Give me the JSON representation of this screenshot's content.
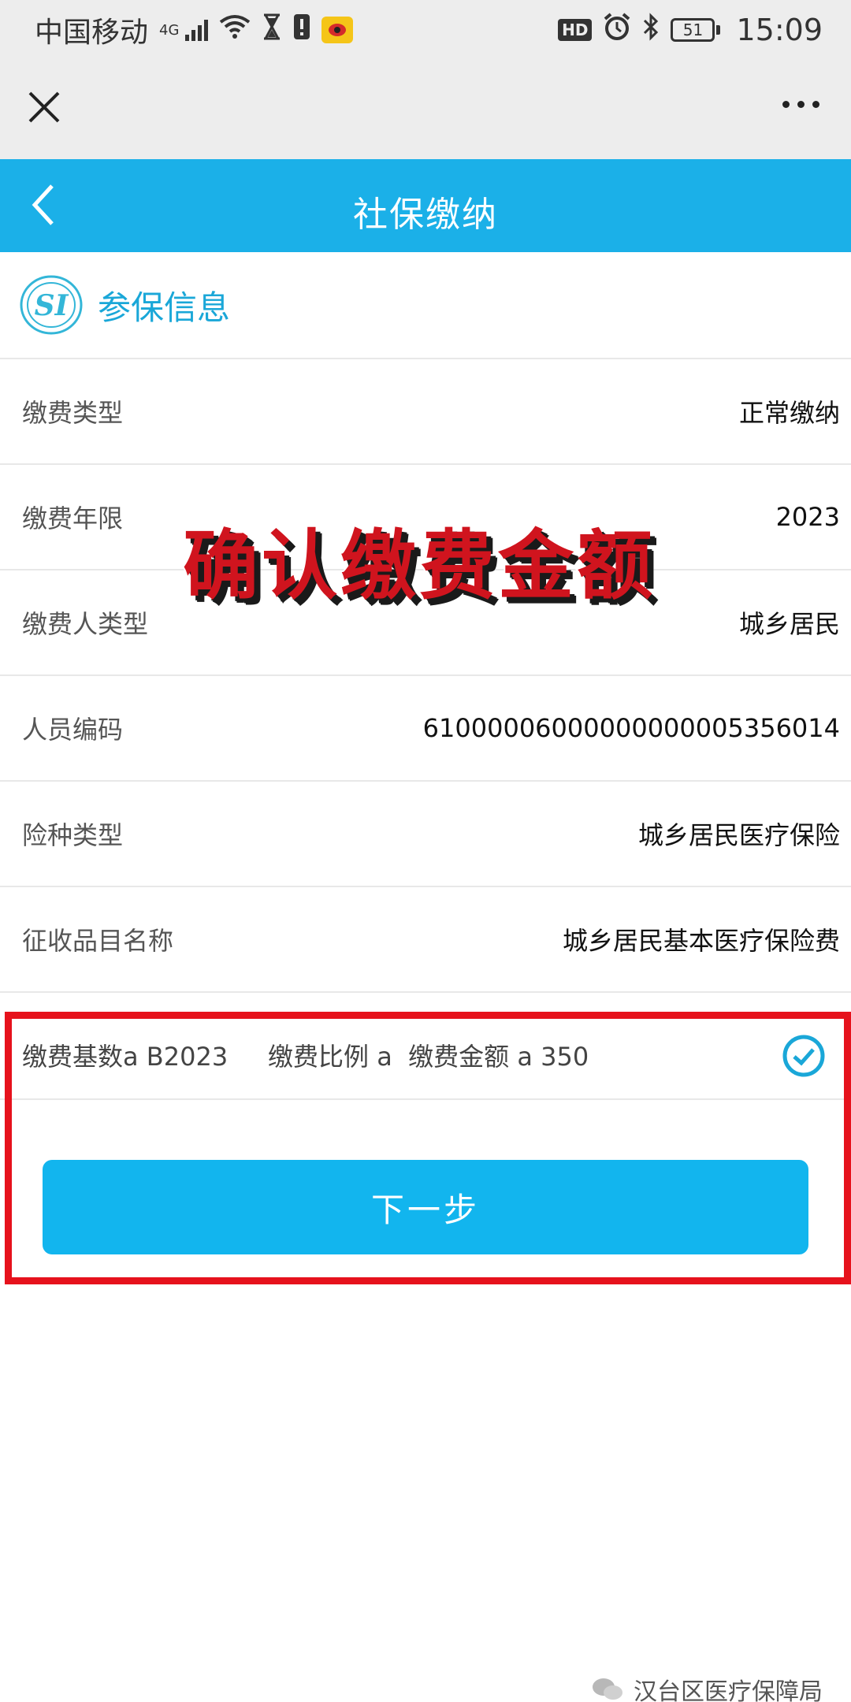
{
  "status_bar": {
    "carrier": "中国移动",
    "network": "4G",
    "hd": "HD",
    "battery": "51",
    "time": "15:09"
  },
  "app": {
    "title": "社保缴纳"
  },
  "section": {
    "title": "参保信息",
    "logo_text": "SI"
  },
  "rows": [
    {
      "label": "缴费类型",
      "value": "正常缴纳"
    },
    {
      "label": "缴费年限",
      "value": "2023"
    },
    {
      "label": "缴费人类型",
      "value": "城乡居民"
    },
    {
      "label": "人员编码",
      "value": "61000006000000000005356014"
    },
    {
      "label": "险种类型",
      "value": "城乡居民医疗保险"
    },
    {
      "label": "征收品目名称",
      "value": "城乡居民基本医疗保险费"
    }
  ],
  "overlay": "确认缴费金额",
  "fee": {
    "text": "缴费基数a B2023     缴费比例 a  缴费金额 a 350"
  },
  "next_button": "下一步",
  "watermark": "汉台区医疗保障局",
  "colors": {
    "header": "#1bb0e8",
    "button": "#12b5ee",
    "highlight": "#e6121c",
    "overlay_text": "#d0141e"
  }
}
